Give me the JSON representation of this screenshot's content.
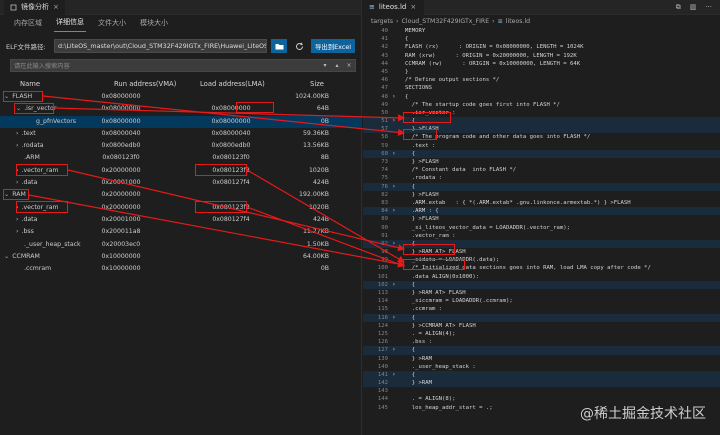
{
  "left": {
    "tab_title": "镜像分析",
    "tab_close": "×",
    "subtabs": [
      "内存区域",
      "详细信息",
      "文件大小",
      "模块大小"
    ],
    "active_subtab": 1,
    "path_label": "ELF文件路径:",
    "path_value": "d:\\LiteOS_master\\out\\Cloud_STM32F429IGTx_FIRE\\Huawei_LiteOS.elf",
    "export_label": "导出到Excel",
    "search_placeholder": "请在此输入搜索内容",
    "columns": [
      "Name",
      "Run address(VMA)",
      "Load address(LMA)",
      "Size"
    ],
    "rows": [
      {
        "name": "FLASH",
        "vma": "0x08000000",
        "lma": "",
        "size": "1024.00KB",
        "level": 0,
        "chev": "v",
        "selected": false
      },
      {
        "name": ".isr_vector",
        "vma": "0x08000000",
        "lma": "0x08000000",
        "size": "64B",
        "level": 1,
        "chev": "v",
        "selected": false
      },
      {
        "name": "g_pfnVectors",
        "vma": "0x08000000",
        "lma": "0x08000000",
        "size": "0B",
        "level": 2,
        "chev": "",
        "selected": true
      },
      {
        "name": ".text",
        "vma": "0x08000040",
        "lma": "0x08000040",
        "size": "59.36KB",
        "level": 1,
        "chev": ">",
        "selected": false
      },
      {
        "name": ".rodata",
        "vma": "0x0800edb0",
        "lma": "0x0800edb0",
        "size": "13.56KB",
        "level": 1,
        "chev": ">",
        "selected": false
      },
      {
        "name": ".ARM",
        "vma": "0x080123f0",
        "lma": "0x080123f0",
        "size": "8B",
        "level": 1,
        "chev": "",
        "selected": false
      },
      {
        "name": ".vector_ram",
        "vma": "0x20000000",
        "lma": "0x080123f8",
        "size": "1020B",
        "level": 1,
        "chev": ">",
        "selected": false
      },
      {
        "name": ".data",
        "vma": "0x20001000",
        "lma": "0x080127f4",
        "size": "424B",
        "level": 1,
        "chev": ">",
        "selected": false
      },
      {
        "name": "RAM",
        "vma": "0x20000000",
        "lma": "",
        "size": "192.00KB",
        "level": 0,
        "chev": "v",
        "selected": false
      },
      {
        "name": ".vector_ram",
        "vma": "0x20000000",
        "lma": "0x080123f8",
        "size": "1020B",
        "level": 1,
        "chev": ">",
        "selected": false
      },
      {
        "name": ".data",
        "vma": "0x20001000",
        "lma": "0x080127f4",
        "size": "424B",
        "level": 1,
        "chev": ">",
        "selected": false
      },
      {
        "name": ".bss",
        "vma": "0x200011a8",
        "lma": "",
        "size": "11.27KB",
        "level": 1,
        "chev": ">",
        "selected": false
      },
      {
        "name": "._user_heap_stack",
        "vma": "0x20003ec0",
        "lma": "",
        "size": "1.50KB",
        "level": 1,
        "chev": "",
        "selected": false
      },
      {
        "name": "CCMRAM",
        "vma": "0x10000000",
        "lma": "",
        "size": "64.00KB",
        "level": 0,
        "chev": "v",
        "selected": false
      },
      {
        "name": ".ccmram",
        "vma": "0x10000000",
        "lma": "",
        "size": "0B",
        "level": 1,
        "chev": "",
        "selected": false
      }
    ]
  },
  "right": {
    "tab_title": "liteos.ld",
    "tab_close": "×",
    "breadcrumbs": [
      "targets",
      "Cloud_STM32F429IGTx_FIRE",
      "liteos.ld"
    ],
    "code_lines": [
      {
        "n": "40",
        "t": "MEMORY",
        "c": "kw"
      },
      {
        "n": "41",
        "t": "{",
        "c": ""
      },
      {
        "n": "42",
        "t": "FLASH (rx)      : ORIGIN = 0x08000000, LENGTH = 1024K",
        "c": ""
      },
      {
        "n": "43",
        "t": "RAM (xrw)      : ORIGIN = 0x20000000, LENGTH = 192K",
        "c": ""
      },
      {
        "n": "44",
        "t": "CCMRAM (rw)      : ORIGIN = 0x10000000, LENGTH = 64K",
        "c": ""
      },
      {
        "n": "45",
        "t": "}",
        "c": ""
      },
      {
        "n": "46",
        "t": "/* Define output sections */",
        "c": "cm"
      },
      {
        "n": "47",
        "t": "SECTIONS",
        "c": "kw"
      },
      {
        "n": "48",
        "t": "{",
        "c": ""
      },
      {
        "n": "49",
        "t": "  /* The startup code goes first into FLASH */",
        "c": "cm"
      },
      {
        "n": "50",
        "t": "  .isr_vector :",
        "c": "id"
      },
      {
        "n": "51",
        "t": "  {",
        "c": ""
      },
      {
        "n": "57",
        "t": "  } >FLASH",
        "c": ""
      },
      {
        "n": "58",
        "t": "  /* The program code and other data goes into FLASH */",
        "c": "cm"
      },
      {
        "n": "59",
        "t": "  .text :",
        "c": "id"
      },
      {
        "n": "60",
        "t": "  {",
        "c": ""
      },
      {
        "n": "73",
        "t": "  } >FLASH",
        "c": ""
      },
      {
        "n": "74",
        "t": "  /* Constant data  into FLASH */",
        "c": "cm"
      },
      {
        "n": "75",
        "t": "  .rodata :",
        "c": "id"
      },
      {
        "n": "76",
        "t": "  {",
        "c": ""
      },
      {
        "n": "82",
        "t": "  } >FLASH",
        "c": ""
      },
      {
        "n": "83",
        "t": "  .ARM.extab   : { *(.ARM.extab* .gnu.linkonce.armextab.*) } >FLASH",
        "c": ""
      },
      {
        "n": "84",
        "t": "  .ARM : {",
        "c": ""
      },
      {
        "n": "89",
        "t": "  } >FLASH",
        "c": ""
      },
      {
        "n": "90",
        "t": "  _si_liteos_vector_data = LOADADDR(.vector_ram);",
        "c": ""
      },
      {
        "n": "91",
        "t": "  .vector_ram :",
        "c": "id"
      },
      {
        "n": "92",
        "t": "  {",
        "c": ""
      },
      {
        "n": "98",
        "t": "  } >RAM AT> FLASH",
        "c": ""
      },
      {
        "n": "99",
        "t": "  _sidata = LOADADDR(.data);",
        "c": ""
      },
      {
        "n": "100",
        "t": "  /* Initialized data sections goes into RAM, load LMA copy after code */",
        "c": "cm"
      },
      {
        "n": "101",
        "t": "  .data ALIGN(0x1000):",
        "c": "id"
      },
      {
        "n": "102",
        "t": "  {",
        "c": ""
      },
      {
        "n": "113",
        "t": "  } >RAM AT> FLASH",
        "c": ""
      },
      {
        "n": "114",
        "t": "  _siccmram = LOADADDR(.ccmram);",
        "c": ""
      },
      {
        "n": "115",
        "t": "  .ccmram :",
        "c": "id"
      },
      {
        "n": "116",
        "t": "  {",
        "c": ""
      },
      {
        "n": "124",
        "t": "  } >CCMRAM AT> FLASH",
        "c": ""
      },
      {
        "n": "125",
        "t": "  . = ALIGN(4);",
        "c": ""
      },
      {
        "n": "126",
        "t": "  .bss :",
        "c": "id"
      },
      {
        "n": "127",
        "t": "  {",
        "c": ""
      },
      {
        "n": "139",
        "t": "  } >RAM",
        "c": ""
      },
      {
        "n": "140",
        "t": "  ._user_heap_stack :",
        "c": "id"
      },
      {
        "n": "141",
        "t": "  {",
        "c": ""
      },
      {
        "n": "142",
        "t": "  } >RAM",
        "c": ""
      },
      {
        "n": "143",
        "t": "",
        "c": ""
      },
      {
        "n": "144",
        "t": "  . = ALIGN(8);",
        "c": ""
      },
      {
        "n": "145",
        "t": "  los_heap_addr_start = .;",
        "c": ""
      }
    ],
    "watermark": "@稀土掘金技术社区"
  },
  "colors": {
    "accent": "#0e639c",
    "selection": "#04395e",
    "annotation_red": "#e51a1a"
  }
}
